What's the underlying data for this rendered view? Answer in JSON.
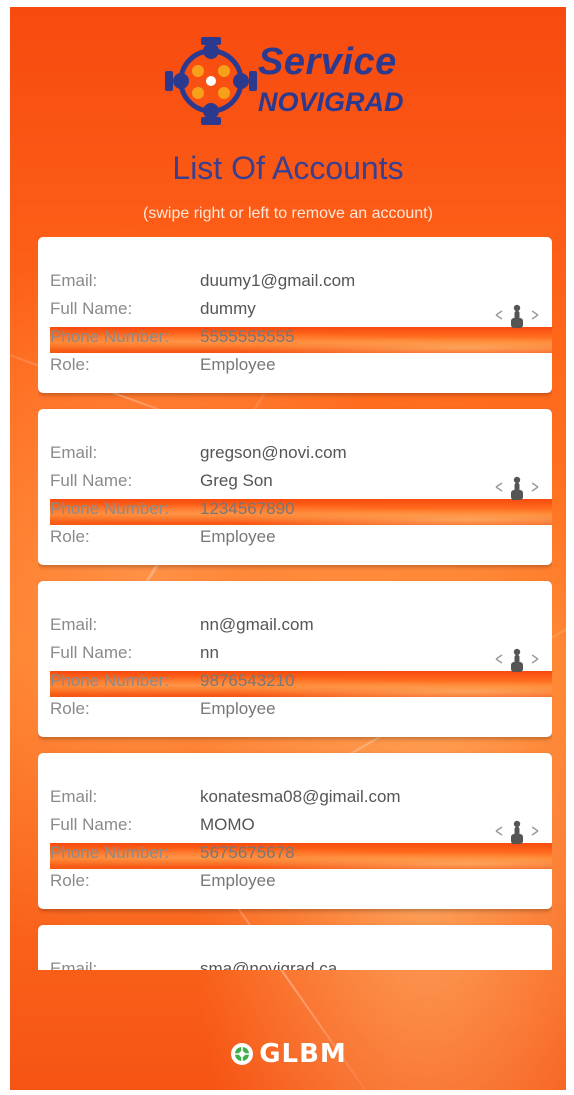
{
  "app": {
    "logo_line1": "Service",
    "logo_line2": "NOVIGRAD",
    "brand_color": "#2b3a8f"
  },
  "page": {
    "title": "List Of Accounts",
    "subtitle": "(swipe right or left to remove an account)"
  },
  "labels": {
    "email": "Email:",
    "full_name": "Full Name:",
    "phone": "Phone Number:",
    "role": "Role:"
  },
  "accounts": [
    {
      "email": "duumy1@gmail.com",
      "full_name": "dummy",
      "phone": "5555555555",
      "role": "Employee"
    },
    {
      "email": "gregson@novi.com",
      "full_name": "Greg Son",
      "phone": "1234567890",
      "role": "Employee"
    },
    {
      "email": "nn@gmail.com",
      "full_name": "nn",
      "phone": "9876543210",
      "role": "Employee"
    },
    {
      "email": "konatesma08@gimail.com",
      "full_name": "MOMO",
      "phone": "5675675678",
      "role": "Employee"
    },
    {
      "email": "sma@novigrad.ca",
      "full_name": "",
      "phone": "",
      "role": ""
    }
  ],
  "icons": {
    "swipe": "swipe-hand-icon",
    "logo": "gear-people-icon",
    "footer": "globe-icon"
  },
  "footer": {
    "brand": "GLBM"
  },
  "colors": {
    "background": "#ff6a1c",
    "card": "#ffffff",
    "title": "#3a3f8f"
  }
}
